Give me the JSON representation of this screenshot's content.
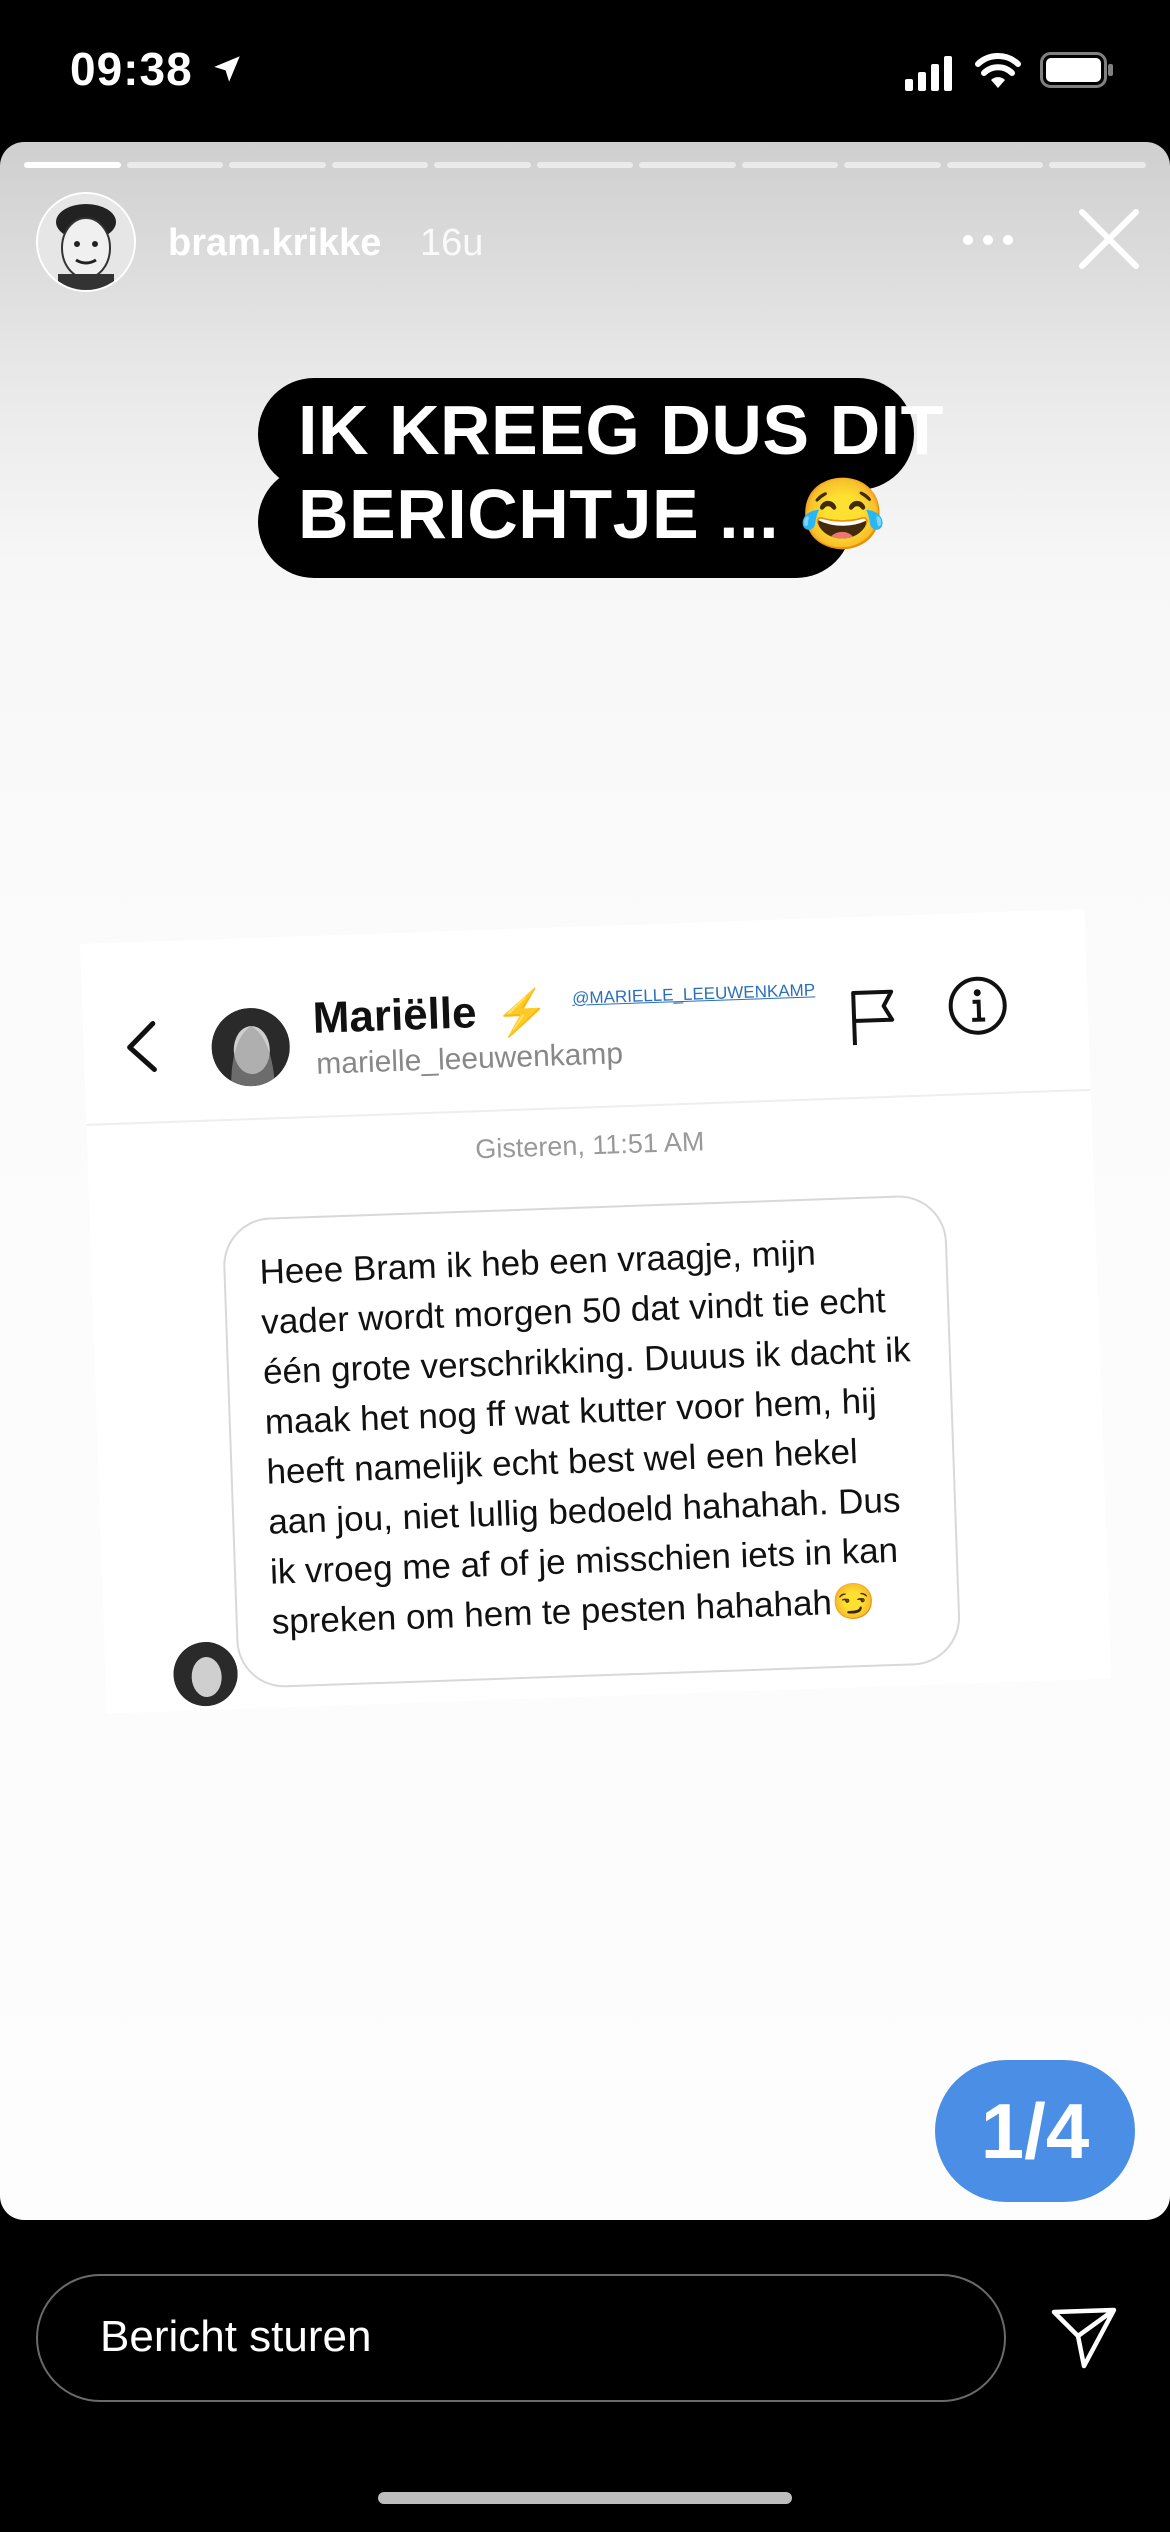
{
  "status": {
    "time": "09:38"
  },
  "story": {
    "username": "bram.krikke",
    "time": "16u",
    "segments": 11,
    "caption_line1": "IK KREEG DUS DIT",
    "caption_line2": "BERICHTJE ... 😂",
    "page_indicator": "1/4"
  },
  "dm": {
    "name": "Mariëlle",
    "name_badge": "⚡",
    "tag": "@MARIELLE_LEEUWENKAMP",
    "handle": "marielle_leeuwenkamp",
    "date": "Gisteren, 11:51 AM",
    "message": "Heee Bram ik heb een vraagje, mijn vader wordt morgen 50 dat vindt tie echt één grote verschrikking. Duuus ik dacht ik maak het nog ff wat kutter voor hem, hij heeft namelijk echt best wel een hekel aan jou, niet lullig bedoeld hahahah. Dus ik vroeg me af of je misschien iets in kan spreken om hem te pesten hahahah😏"
  },
  "reply": {
    "placeholder": "Bericht sturen"
  },
  "colors": {
    "accent": "#4a8ee6",
    "background": "#000000"
  }
}
